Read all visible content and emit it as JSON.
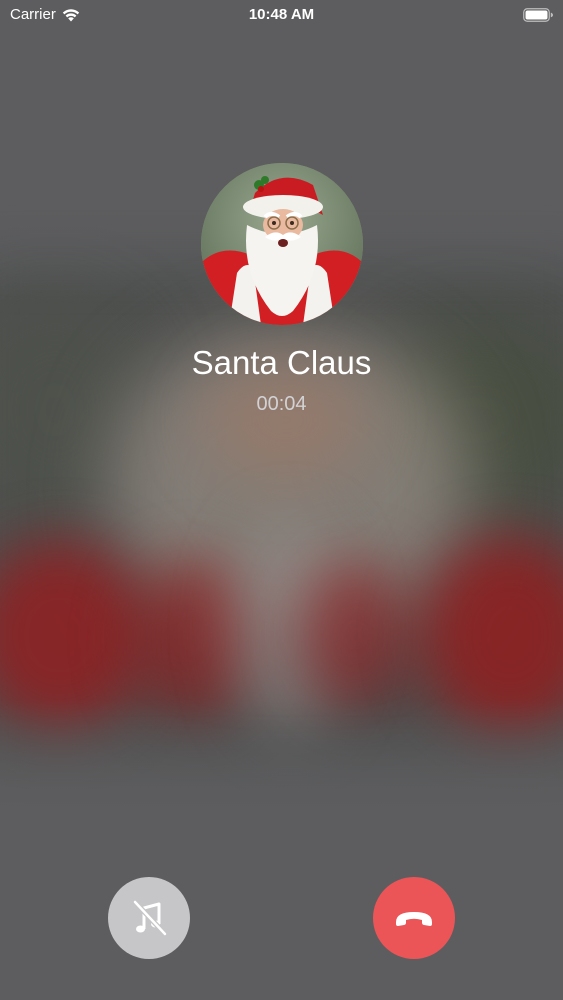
{
  "status_bar": {
    "carrier": "Carrier",
    "time": "10:48 AM",
    "icons": [
      "wifi-icon",
      "battery-icon"
    ]
  },
  "call": {
    "caller_name": "Santa Claus",
    "duration": "00:04",
    "avatar_icon": "caller-avatar"
  },
  "actions": {
    "mute_icon": "music-mute-icon",
    "end_call_icon": "phone-hangup-icon"
  },
  "colors": {
    "background": "#5d5d5f",
    "end_call": "#eb5558",
    "mute_button": "#c6c6c8",
    "text": "#ffffff",
    "timer_text": "#d2d2d4"
  }
}
